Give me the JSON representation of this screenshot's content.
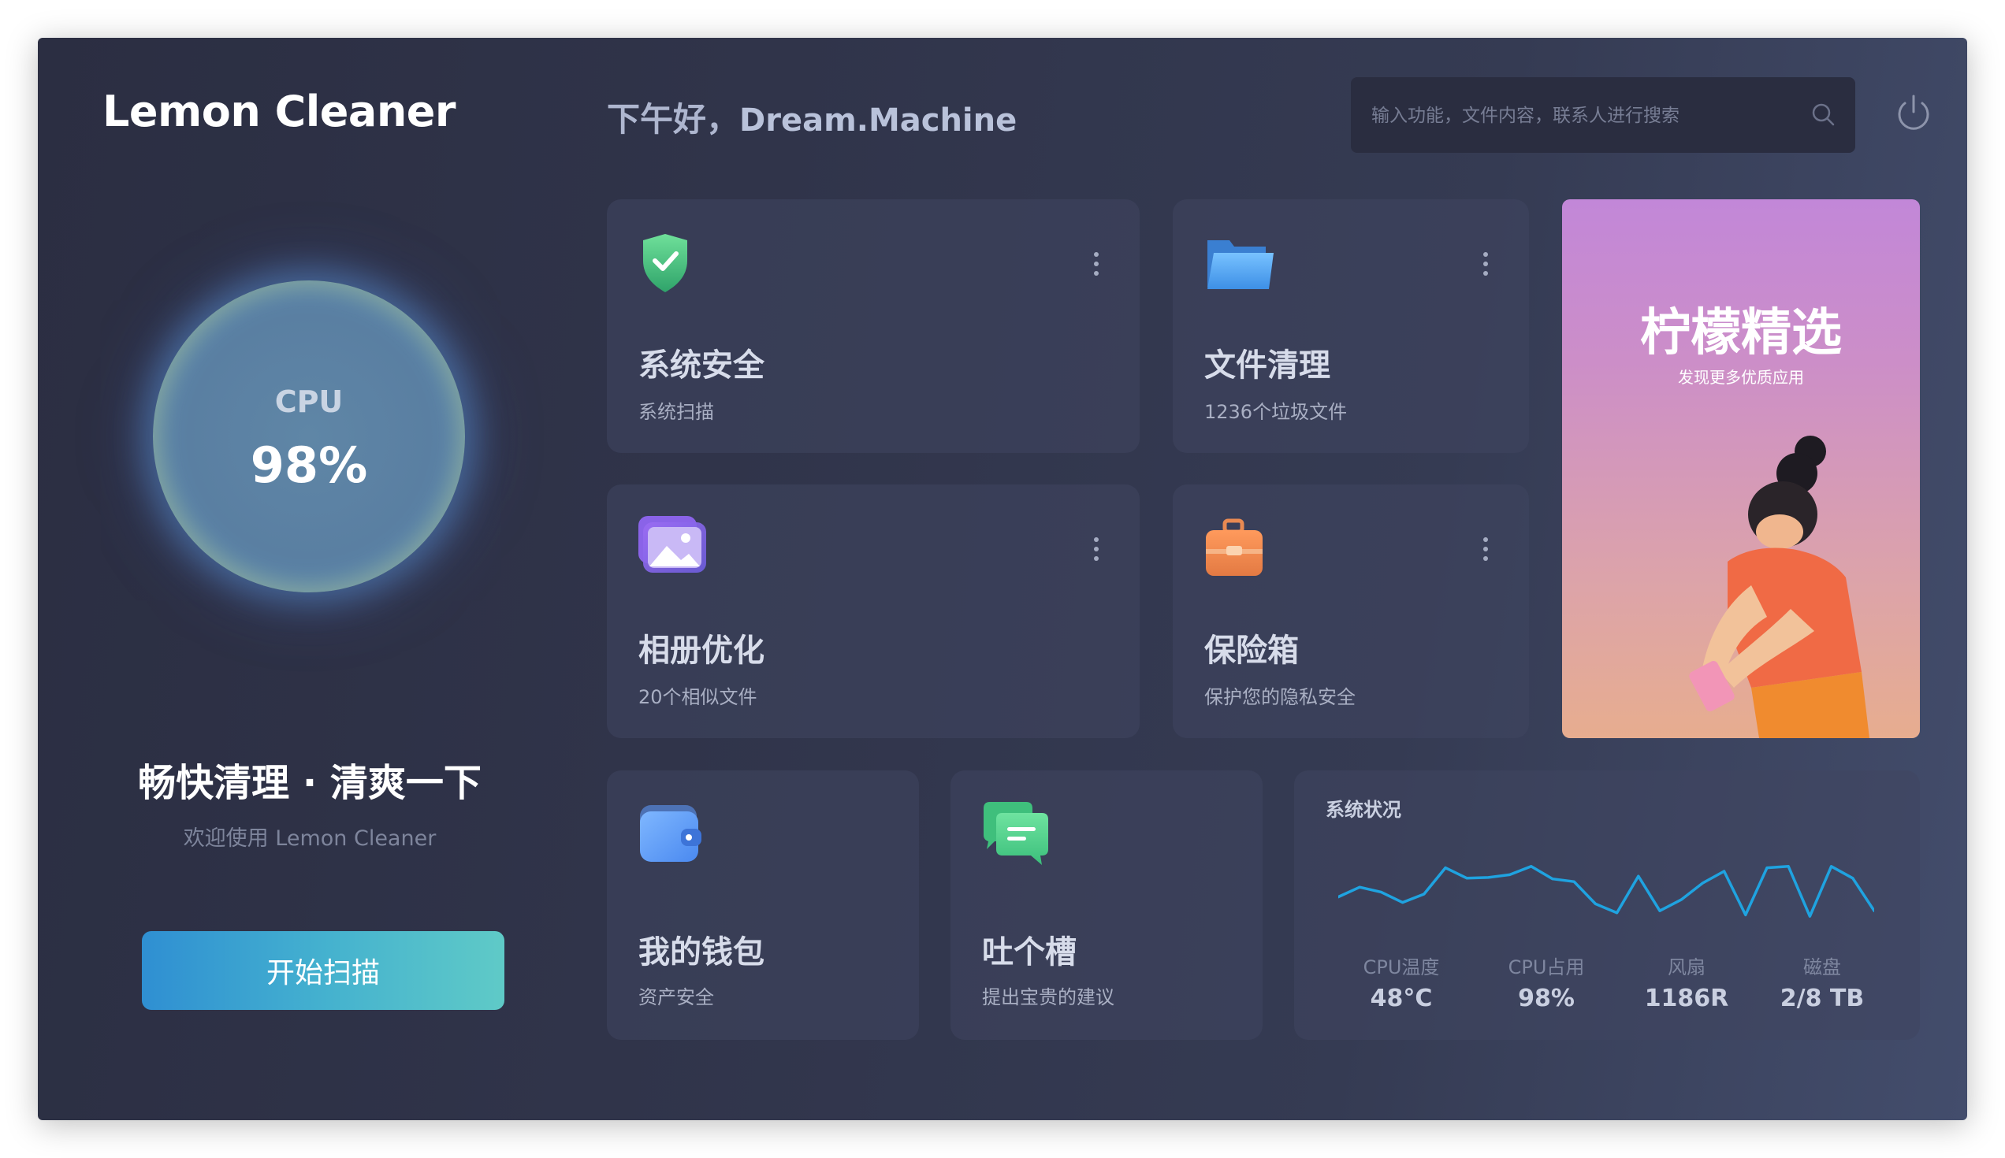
{
  "app": {
    "title": "Lemon Cleaner",
    "greeting": "下午好，",
    "user_name": "Dream.Machine"
  },
  "search": {
    "placeholder": "输入功能，文件内容，联系人进行搜索"
  },
  "cpu": {
    "label": "CPU",
    "value": "98%"
  },
  "left_panel": {
    "slogan": "畅快清理 · 清爽一下",
    "welcome": "欢迎使用 Lemon Cleaner",
    "scan_button": "开始扫描"
  },
  "cards": [
    {
      "id": "system-security",
      "title": "系统安全",
      "subtitle": "系统扫描",
      "icon": "shield-check-icon"
    },
    {
      "id": "file-cleanup",
      "title": "文件清理",
      "subtitle": "1236个垃圾文件",
      "icon": "folder-icon"
    },
    {
      "id": "album-optimize",
      "title": "相册优化",
      "subtitle": "20个相似文件",
      "icon": "photo-icon"
    },
    {
      "id": "safe-box",
      "title": "保险箱",
      "subtitle": "保护您的隐私安全",
      "icon": "briefcase-icon"
    },
    {
      "id": "wallet",
      "title": "我的钱包",
      "subtitle": "资产安全",
      "icon": "wallet-icon"
    },
    {
      "id": "feedback",
      "title": "吐个槽",
      "subtitle": "提出宝贵的建议",
      "icon": "chat-bubbles-icon"
    }
  ],
  "promo": {
    "title": "柠檬精选",
    "subtitle": "发现更多优质应用"
  },
  "system_status": {
    "label": "系统状况",
    "stats": [
      {
        "name": "CPU温度",
        "value": "48°C"
      },
      {
        "name": "CPU占用",
        "value": "98%"
      },
      {
        "name": "风扇",
        "value": "1186R"
      },
      {
        "name": "磁盘",
        "value": "2/8 TB"
      }
    ],
    "line_color": "#1fa3e0",
    "sparkline": [
      0.62,
      0.48,
      0.55,
      0.7,
      0.58,
      0.2,
      0.35,
      0.34,
      0.3,
      0.18,
      0.36,
      0.4,
      0.72,
      0.85,
      0.32,
      0.82,
      0.66,
      0.42,
      0.25,
      0.88,
      0.2,
      0.18,
      0.9,
      0.18,
      0.35,
      0.82
    ]
  },
  "colors": {
    "accent_start": "#2f8fd2",
    "accent_end": "#5fcac7",
    "background": "#30344a"
  }
}
